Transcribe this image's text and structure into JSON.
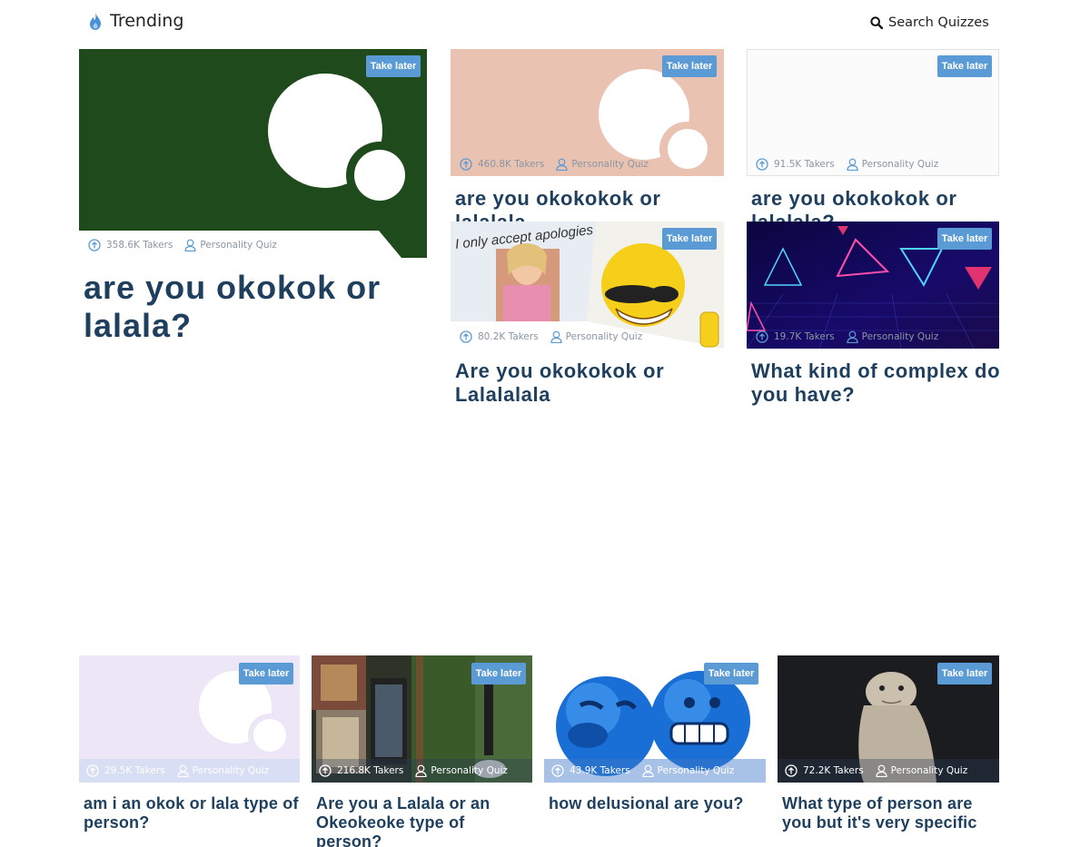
{
  "header": {
    "title": "Trending",
    "search_label": "Search Quizzes"
  },
  "colors": {
    "accent": "#5b9bd5",
    "title_text": "#1e3f5d",
    "meta_text": "#8a96a3"
  },
  "take_later_label": "Take later",
  "quizzes": [
    {
      "title": "are you okokok or lalala?",
      "takers": "358.6K Takers",
      "type": "Personality Quiz",
      "image": "green-placeholder"
    },
    {
      "title": "are you okokokok or lalalala",
      "takers": "460.8K Takers",
      "type": "Personality Quiz",
      "image": "peach-placeholder"
    },
    {
      "title": "are you okokokok or lalalala?",
      "takers": "91.5K Takers",
      "type": "Personality Quiz",
      "image": "white-placeholder"
    },
    {
      "title": "Are you okokokok or Lalalalala",
      "takers": "80.2K Takers",
      "type": "Personality Quiz",
      "image": "meme-photo"
    },
    {
      "title": "What kind of complex do you have?",
      "takers": "19.7K Takers",
      "type": "Personality Quiz",
      "image": "neon-triangles"
    },
    {
      "title": "am i an okok or lala type of person?",
      "takers": "29.5K Takers",
      "type": "Personality Quiz",
      "image": "lavender-placeholder"
    },
    {
      "title": "Are you a Lalala or an Okeokeoke type of person?",
      "takers": "216.8K Takers",
      "type": "Personality Quiz",
      "image": "collage-photo"
    },
    {
      "title": "how delusional are you?",
      "takers": "43.9K Takers",
      "type": "Personality Quiz",
      "image": "blue-emoji"
    },
    {
      "title": "What type of person are you but it's very specific",
      "takers": "72.2K Takers",
      "type": "Personality Quiz",
      "image": "creature-photo"
    }
  ]
}
